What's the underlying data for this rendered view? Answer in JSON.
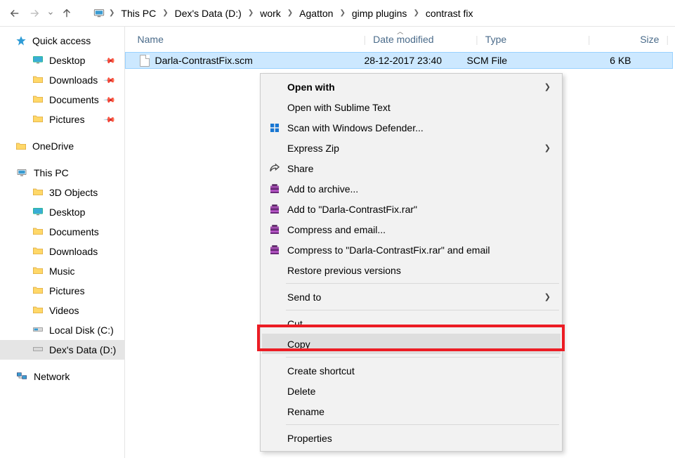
{
  "address": {
    "crumbs": [
      "This PC",
      "Dex's Data (D:)",
      "work",
      "Agatton",
      "gimp plugins",
      "contrast fix"
    ]
  },
  "columns": {
    "name": "Name",
    "date": "Date modified",
    "type": "Type",
    "size": "Size"
  },
  "navtree": {
    "quick_access": "Quick access",
    "qa_items": [
      {
        "label": "Desktop",
        "icon": "desktop"
      },
      {
        "label": "Downloads",
        "icon": "downloads"
      },
      {
        "label": "Documents",
        "icon": "documents"
      },
      {
        "label": "Pictures",
        "icon": "pictures"
      }
    ],
    "onedrive": "OneDrive",
    "this_pc": "This PC",
    "pc_items": [
      {
        "label": "3D Objects",
        "icon": "3d"
      },
      {
        "label": "Desktop",
        "icon": "desktop"
      },
      {
        "label": "Documents",
        "icon": "documents"
      },
      {
        "label": "Downloads",
        "icon": "downloads"
      },
      {
        "label": "Music",
        "icon": "music"
      },
      {
        "label": "Pictures",
        "icon": "pictures"
      },
      {
        "label": "Videos",
        "icon": "videos"
      },
      {
        "label": "Local Disk (C:)",
        "icon": "disk-c"
      },
      {
        "label": "Dex's Data (D:)",
        "icon": "disk-d",
        "selected": true
      }
    ],
    "network": "Network"
  },
  "file": {
    "name": "Darla-ContrastFix.scm",
    "date": "28-12-2017 23:40",
    "type": "SCM File",
    "size": "6 KB"
  },
  "context_menu": {
    "items": [
      {
        "label": "Open with",
        "bold": true,
        "submenu": true
      },
      {
        "label": "Open with Sublime Text"
      },
      {
        "label": "Scan with Windows Defender...",
        "icon": "defender"
      },
      {
        "label": "Express Zip",
        "submenu": true
      },
      {
        "label": "Share",
        "icon": "share"
      },
      {
        "label": "Add to archive...",
        "icon": "winrar"
      },
      {
        "label": "Add to \"Darla-ContrastFix.rar\"",
        "icon": "winrar"
      },
      {
        "label": "Compress and email...",
        "icon": "winrar"
      },
      {
        "label": "Compress to \"Darla-ContrastFix.rar\" and email",
        "icon": "winrar"
      },
      {
        "label": "Restore previous versions"
      },
      {
        "sep": true
      },
      {
        "label": "Send to",
        "submenu": true
      },
      {
        "sep": true
      },
      {
        "label": "Cut"
      },
      {
        "label": "Copy",
        "hover": true,
        "highlight": true
      },
      {
        "sep": true
      },
      {
        "label": "Create shortcut"
      },
      {
        "label": "Delete"
      },
      {
        "label": "Rename"
      },
      {
        "sep": true
      },
      {
        "label": "Properties"
      }
    ]
  }
}
